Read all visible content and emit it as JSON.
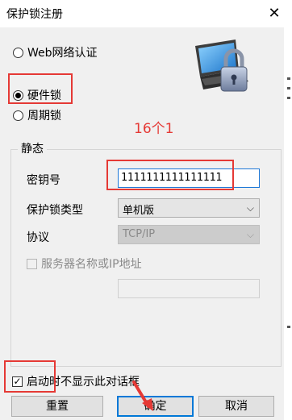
{
  "window": {
    "title": "保护锁注册",
    "close_icon": "close-icon"
  },
  "lock_type": {
    "options": [
      {
        "label": "Web网络认证",
        "checked": false
      },
      {
        "label": "硬件锁",
        "checked": true
      },
      {
        "label": "周期锁",
        "checked": false
      }
    ]
  },
  "image": {
    "icon": "laptop-lock-icon"
  },
  "annotations": {
    "note": "16个1",
    "color": "#e53935"
  },
  "static_group": {
    "title": "静态",
    "key_label": "密钥号",
    "key_value": "1111111111111111",
    "lock_type_label": "保护锁类型",
    "lock_type_value": "单机版",
    "protocol_label": "协议",
    "protocol_value": "TCP/IP",
    "server_checkbox_label": "服务器名称或IP地址",
    "server_checked": false
  },
  "footer": {
    "startup_checkbox_label": "启动时不显示此对话框",
    "startup_checked": true,
    "reset_label": "重置",
    "ok_label": "确定",
    "cancel_label": "取消"
  }
}
